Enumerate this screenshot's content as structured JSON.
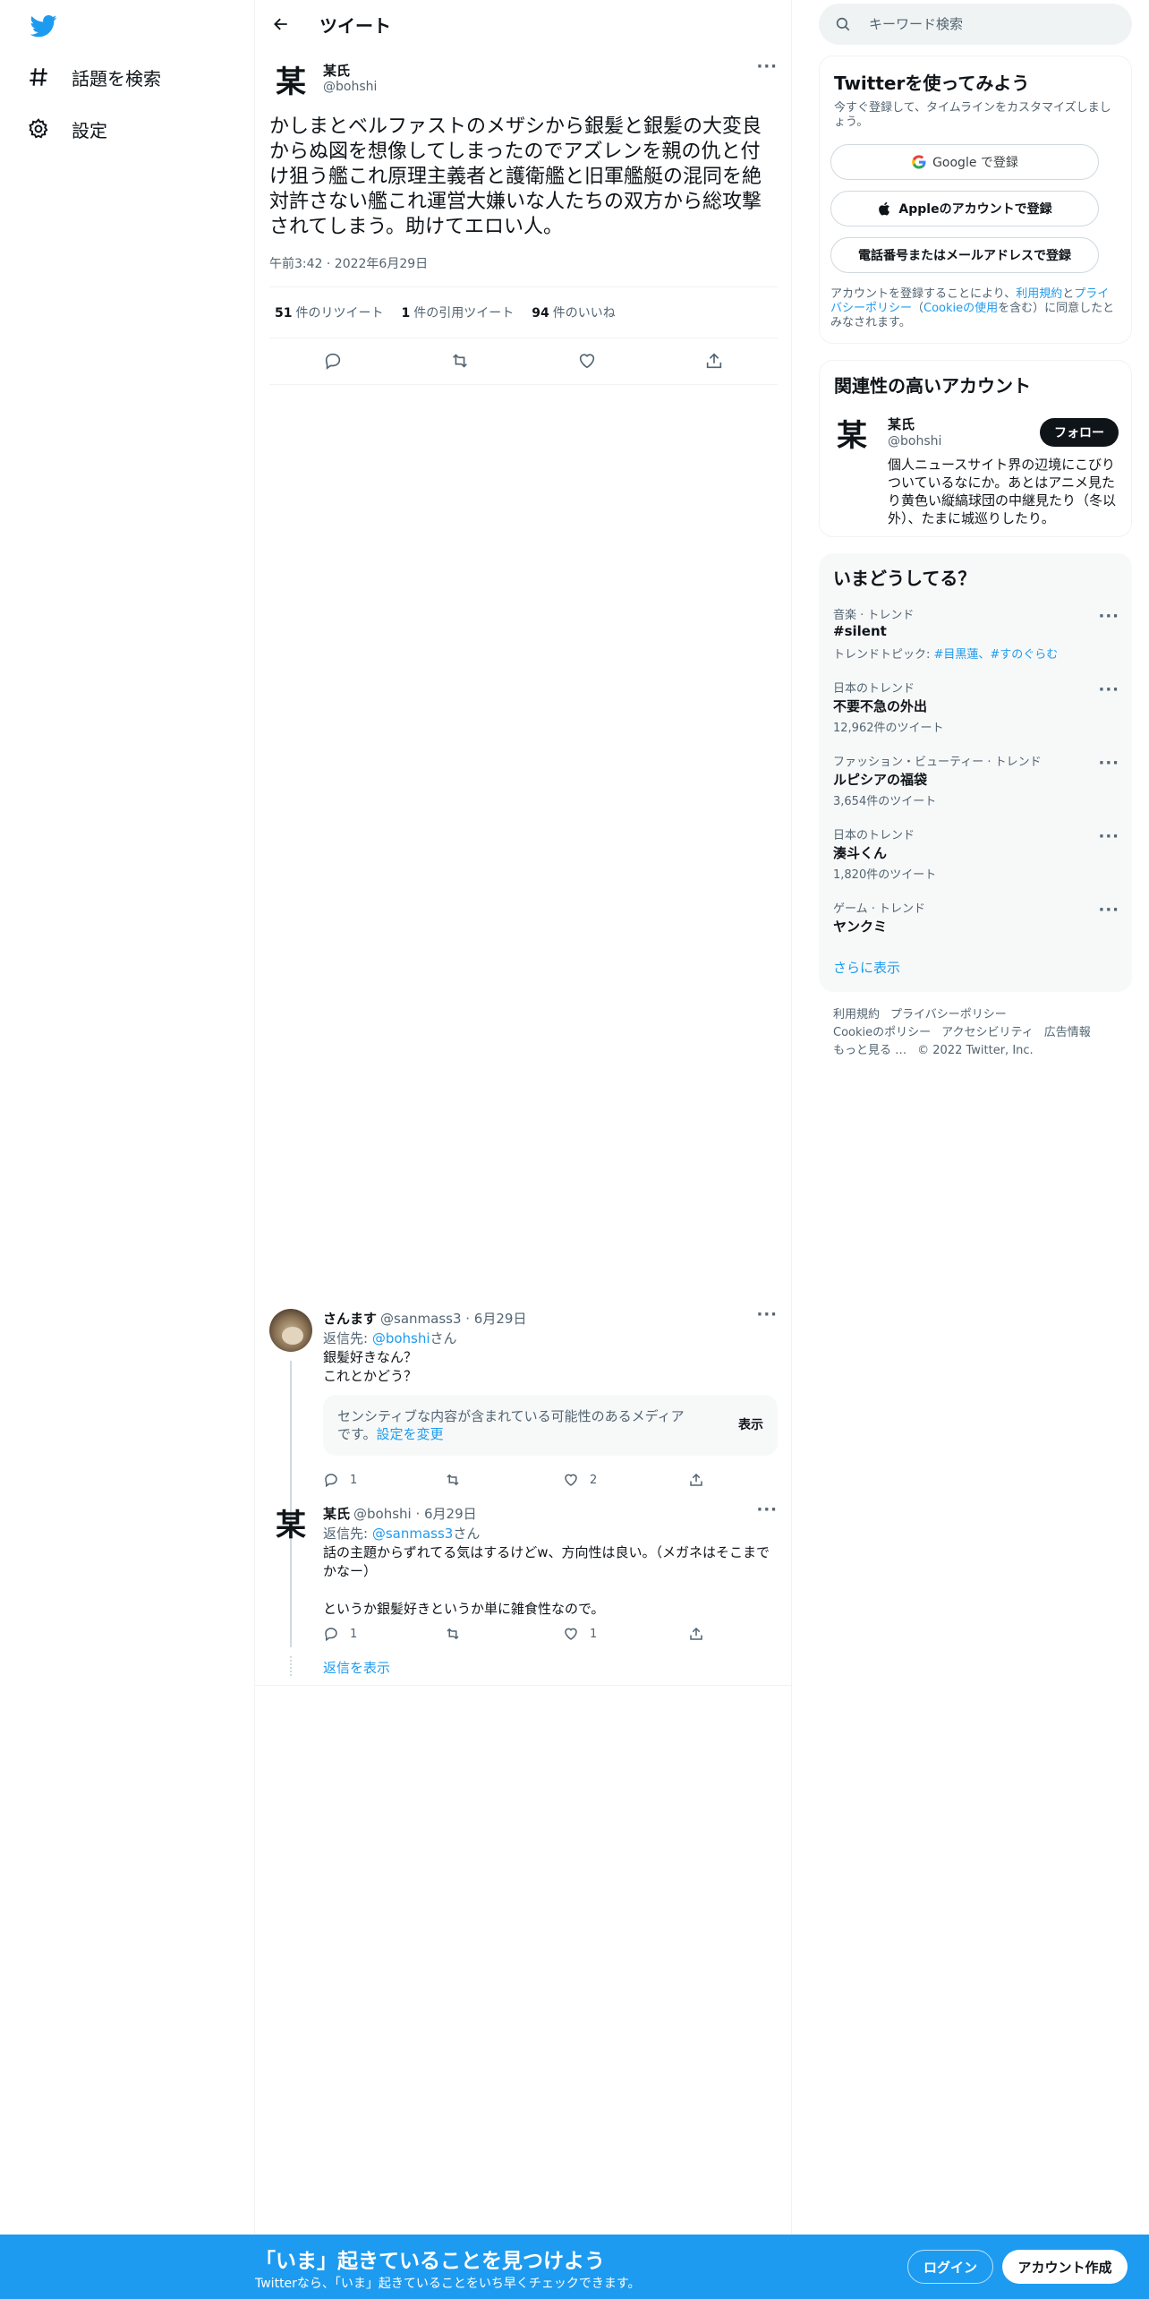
{
  "brand": {
    "accent": "#1d9bf0",
    "text": "#0f1419",
    "muted": "#536471"
  },
  "nav": {
    "logo_icon": "twitter-bird-icon",
    "items": [
      {
        "label": "話題を検索",
        "icon": "hashtag-icon"
      },
      {
        "label": "設定",
        "icon": "gear-icon"
      }
    ]
  },
  "header": {
    "title": "ツイート",
    "back_icon": "arrow-left-icon"
  },
  "main_tweet": {
    "avatar_char": "某",
    "name": "某氏",
    "handle": "@bohshi",
    "text": "かしまとベルファストのメザシから銀髪と銀髪の大変良からぬ図を想像してしまったのでアズレンを親の仇と付け狙う艦これ原理主義者と護衛艦と旧軍艦艇の混同を絶対許さない艦これ運営大嫌いな人たちの双方から総攻撃されてしまう。助けてエロい人。",
    "timestamp": "午前3:42 · 2022年6月29日",
    "stats": {
      "retweets": "51",
      "retweets_label": "件のリツイート",
      "quotes": "1",
      "quotes_label": "件の引用ツイート",
      "likes": "94",
      "likes_label": "件のいいね"
    }
  },
  "replies": [
    {
      "name": "さんます",
      "handle_date": "@sanmass3 · 6月29日",
      "reply_to_prefix": "返信先: ",
      "reply_to": "@bohshi",
      "reply_to_suffix": "さん",
      "text": "銀髪好きなん？\nこれとかどう？",
      "sensitive": {
        "text": "センシティブな内容が含まれている可能性のあるメディアです。",
        "link": "設定を変更",
        "show": "表示"
      },
      "reply_count": "1",
      "like_count": "2"
    },
    {
      "avatar_char": "某",
      "name": "某氏",
      "handle_date": "@bohshi · 6月29日",
      "reply_to_prefix": "返信先: ",
      "reply_to": "@sanmass3",
      "reply_to_suffix": "さん",
      "text": "話の主題からずれてる気はするけどw、方向性は良い。（メガネはそこまでかなー）\n\nというか銀髪好きというか単に雑食性なので。",
      "reply_count": "1",
      "like_count": "1"
    }
  ],
  "show_replies": "返信を表示",
  "search": {
    "placeholder": "キーワード検索"
  },
  "signup": {
    "title": "Twitterを使ってみよう",
    "subtitle": "今すぐ登録して、タイムラインをカスタマイズしましょう。",
    "google": "Google で登録",
    "apple": "Appleのアカウントで登録",
    "phone": "電話番号またはメールアドレスで登録",
    "terms_pre": "アカウントを登録することにより、",
    "terms_link1": "利用規約",
    "terms_mid1": "と",
    "terms_link2": "プライバシーポリシー",
    "terms_mid2": "（",
    "terms_link3": "Cookieの使用",
    "terms_post": "を含む）に同意したとみなされます。"
  },
  "related": {
    "title": "関連性の高いアカウント",
    "avatar_char": "某",
    "name": "某氏",
    "handle": "@bohshi",
    "follow": "フォロー",
    "bio": "個人ニュースサイト界の辺境にこびりついているなにか。あとはアニメ見たり黄色い縦縞球団の中継見たり（冬以外）、たまに城巡りしたり。"
  },
  "trends": {
    "title": "いまどうしてる？",
    "items": [
      {
        "category": "音楽 · トレンド",
        "name": "#silent",
        "meta_prefix": "トレンドトピック: ",
        "meta_links": "#目黒蓮、#すのぐらむ"
      },
      {
        "category": "日本のトレンド",
        "name": "不要不急の外出",
        "meta": "12,962件のツイート"
      },
      {
        "category": "ファッション・ビューティー · トレンド",
        "name": "ルピシアの福袋",
        "meta": "3,654件のツイート"
      },
      {
        "category": "日本のトレンド",
        "name": "湊斗くん",
        "meta": "1,820件のツイート"
      },
      {
        "category": "ゲーム · トレンド",
        "name": "ヤンクミ",
        "meta": ""
      }
    ],
    "more": "さらに表示"
  },
  "footer": {
    "links": [
      "利用規約",
      "プライバシーポリシー",
      "Cookieのポリシー",
      "アクセシビリティ",
      "広告情報",
      "もっと見る …",
      "© 2022 Twitter, Inc."
    ]
  },
  "bottom_bar": {
    "title": "「いま」起きていることを見つけよう",
    "subtitle": "Twitterなら、「いま」起きていることをいち早くチェックできます。",
    "login": "ログイン",
    "signup": "アカウント作成"
  }
}
